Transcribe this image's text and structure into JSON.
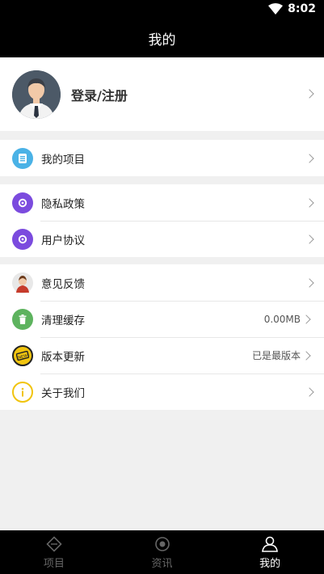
{
  "status_bar": {
    "time": "8:02"
  },
  "header": {
    "title": "我的"
  },
  "profile": {
    "login_label": "登录/注册"
  },
  "menu": {
    "projects": "我的项目",
    "privacy": "隐私政策",
    "agreement": "用户协议",
    "feedback": "意见反馈",
    "clear_cache": "清理缓存",
    "cache_size": "0.00MB",
    "update": "版本更新",
    "update_status": "已是最版本",
    "about": "关于我们"
  },
  "nav": {
    "items": [
      {
        "label": "项目",
        "icon": "diamond-icon"
      },
      {
        "label": "资讯",
        "icon": "target-icon"
      },
      {
        "label": "我的",
        "icon": "user-icon"
      }
    ],
    "active_index": 2
  },
  "colors": {
    "projects_icon": "#4ab2e6",
    "privacy_icon": "#7b4bde",
    "clear_icon": "#5db35e",
    "update_icon": "#f1c40f",
    "about_icon": "#f1c40f"
  }
}
